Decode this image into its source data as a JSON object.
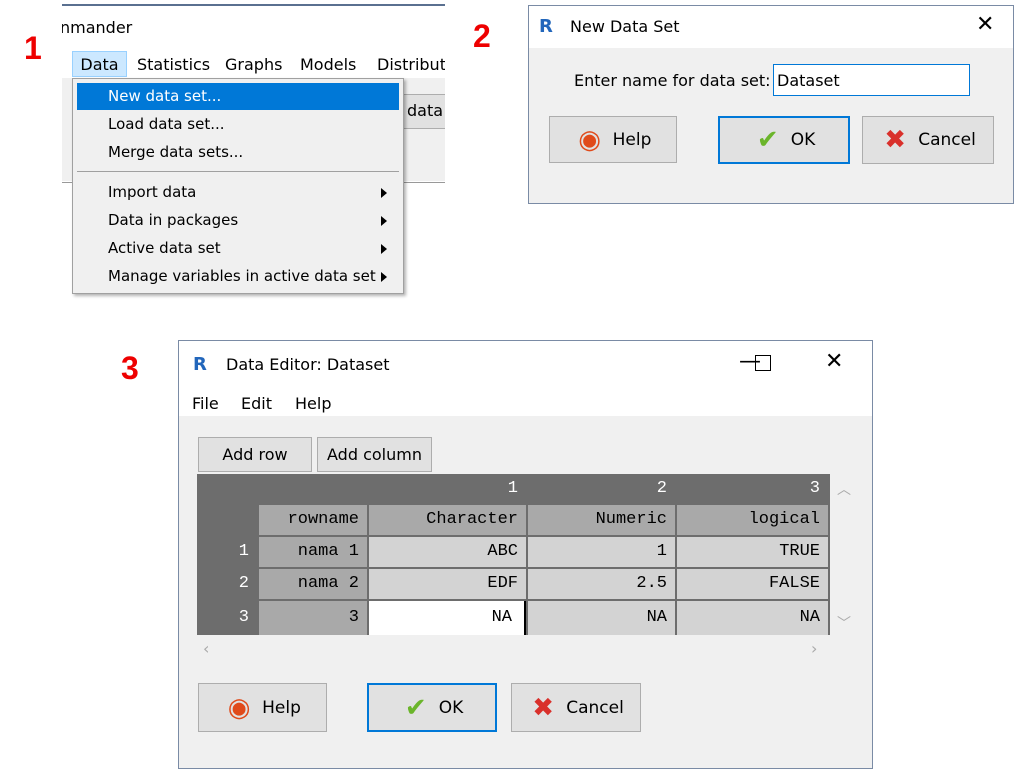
{
  "labels": [
    "1",
    "2",
    "3"
  ],
  "panel1": {
    "title_fragment": "nmander",
    "menubar": [
      "Data",
      "Statistics",
      "Graphs",
      "Models",
      "Distribut"
    ],
    "toolbar_fragment": "data",
    "menu": {
      "items": [
        {
          "label": "New data set...",
          "submenu": false,
          "selected": true
        },
        {
          "label": "Load data set...",
          "submenu": false
        },
        {
          "label": "Merge data sets...",
          "submenu": false
        },
        {
          "label": "Import data",
          "submenu": true
        },
        {
          "label": "Data in packages",
          "submenu": true
        },
        {
          "label": "Active data set",
          "submenu": true
        },
        {
          "label": "Manage variables in active data set",
          "submenu": true
        }
      ]
    }
  },
  "panel2": {
    "title": "New Data Set",
    "prompt": "Enter name for data set:",
    "value": "Dataset",
    "help": "Help",
    "ok": "OK",
    "cancel": "Cancel"
  },
  "panel3": {
    "title": "Data Editor: Dataset",
    "menu": [
      "File",
      "Edit",
      "Help"
    ],
    "add_row": "Add row",
    "add_column": "Add column",
    "col_numbers": [
      "1",
      "2",
      "3"
    ],
    "headers": [
      "rowname",
      "Character",
      "Numeric",
      "logical"
    ],
    "rows": [
      {
        "num": "1",
        "cells": [
          "nama 1",
          "ABC",
          "1",
          "TRUE"
        ]
      },
      {
        "num": "2",
        "cells": [
          "nama 2",
          "EDF",
          "2.5",
          "FALSE"
        ]
      },
      {
        "num": "3",
        "cells": [
          "3",
          "NA",
          "NA",
          "NA"
        ]
      }
    ],
    "help": "Help",
    "ok": "OK",
    "cancel": "Cancel"
  },
  "colors": {
    "accent": "#0078d7",
    "label": "#e00000",
    "table_dark": "#6d6d6d"
  }
}
